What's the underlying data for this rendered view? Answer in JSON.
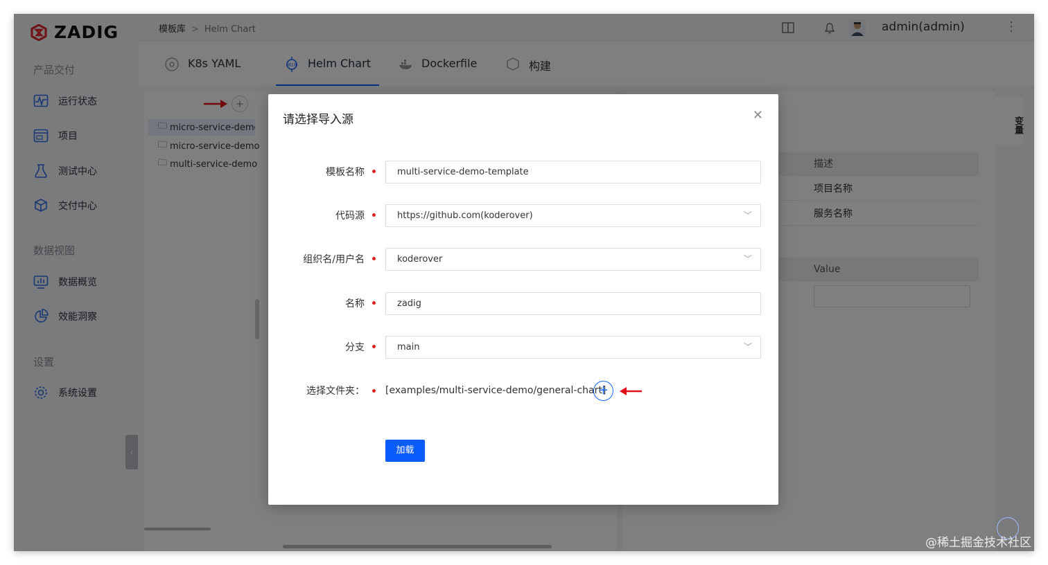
{
  "brand": {
    "name": "ZADIG",
    "color": "#e0242d"
  },
  "sidebar": {
    "sections": [
      {
        "title": "产品交付",
        "items": [
          {
            "label": "运行状态",
            "icon": "pulse-icon"
          },
          {
            "label": "项目",
            "icon": "project-icon"
          },
          {
            "label": "测试中心",
            "icon": "flask-icon"
          },
          {
            "label": "交付中心",
            "icon": "package-icon"
          }
        ]
      },
      {
        "title": "数据视图",
        "items": [
          {
            "label": "数据概览",
            "icon": "monitor-chart-icon"
          },
          {
            "label": "效能洞察",
            "icon": "pie-chart-icon"
          }
        ]
      },
      {
        "title": "设置",
        "items": [
          {
            "label": "系统设置",
            "icon": "gear-icon"
          }
        ]
      }
    ]
  },
  "header": {
    "breadcrumb": [
      "模板库",
      "Helm Chart"
    ],
    "user": "admin(admin)"
  },
  "tabs": [
    {
      "label": "K8s YAML",
      "icon": "k8s-icon",
      "active": false
    },
    {
      "label": "Helm Chart",
      "icon": "helm-icon",
      "active": true
    },
    {
      "label": "Dockerfile",
      "icon": "docker-icon",
      "active": false
    },
    {
      "label": "构建",
      "icon": "build-icon",
      "active": false
    }
  ],
  "tree": {
    "items": [
      "micro-service-demo",
      "micro-service-demo",
      "multi-service-demo"
    ]
  },
  "right_panel": {
    "var_tab": "变量",
    "desc_header": "描述",
    "rows": [
      "项目名称",
      "服务名称"
    ],
    "value_header": "Value"
  },
  "modal": {
    "title": "请选择导入源",
    "fields": {
      "template_name": {
        "label": "模板名称",
        "value": "multi-service-demo-template"
      },
      "code_source": {
        "label": "代码源",
        "value": "https://github.com(koderover)"
      },
      "org": {
        "label": "组织名/用户名",
        "value": "koderover"
      },
      "name": {
        "label": "名称",
        "value": "zadig"
      },
      "branch": {
        "label": "分支",
        "value": "main"
      },
      "folder": {
        "label": "选择文件夹：",
        "value": "[examples/multi-service-demo/general-chart]"
      }
    },
    "load_button": "加载"
  },
  "watermark": "@稀土掘金技术社区",
  "colors": {
    "primary": "#0a5cff",
    "required": "#e02020",
    "annotation_arrow": "#e0101a"
  }
}
